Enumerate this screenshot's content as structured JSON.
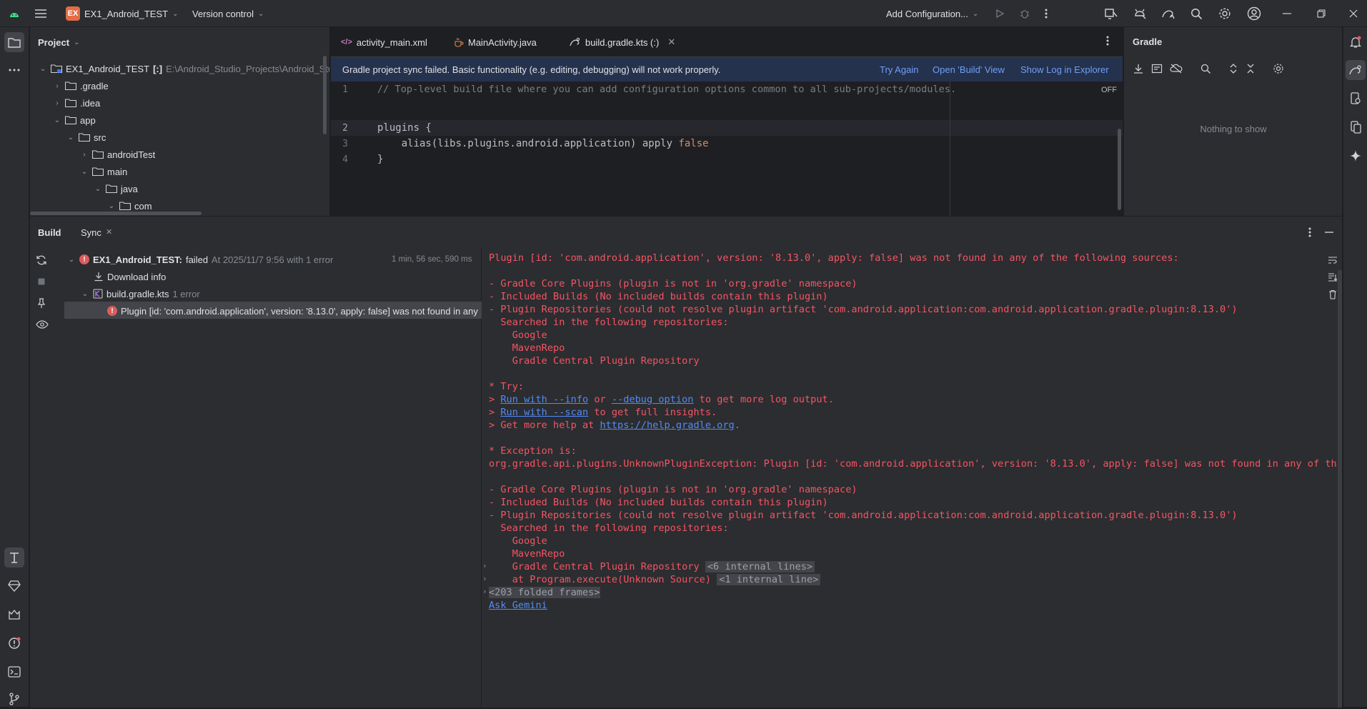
{
  "titlebar": {
    "project_badge": "EX",
    "project_name": "EX1_Android_TEST",
    "vcs": "Version control",
    "run_config": "Add Configuration..."
  },
  "project_panel": {
    "title": "Project",
    "tree": [
      {
        "label": "EX1_Android_TEST",
        "suffix": "[:]",
        "path": "E:\\Android_Studio_Projects\\Android_Stud"
      },
      {
        "label": ".gradle"
      },
      {
        "label": ".idea"
      },
      {
        "label": "app"
      },
      {
        "label": "src"
      },
      {
        "label": "androidTest"
      },
      {
        "label": "main"
      },
      {
        "label": "java"
      },
      {
        "label": "com"
      }
    ]
  },
  "editor": {
    "tabs": [
      {
        "label": "activity_main.xml"
      },
      {
        "label": "MainActivity.java"
      },
      {
        "label": "build.gradle.kts (:)"
      }
    ],
    "banner": {
      "message": "Gradle project sync failed. Basic functionality (e.g. editing, debugging) will not work properly.",
      "try_again": "Try Again",
      "open_build": "Open 'Build' View",
      "show_log": "Show Log in Explorer"
    },
    "off_label": "OFF",
    "lines": [
      {
        "num": "1",
        "text": "// Top-level build file where you can add configuration options common to all sub-projects/modules."
      },
      {
        "num": "2",
        "text": "plugins {"
      },
      {
        "num": "3",
        "text": "    alias(libs.plugins.android.application) apply ",
        "kw": "false"
      },
      {
        "num": "4",
        "text": "}"
      }
    ]
  },
  "gradle_panel": {
    "title": "Gradle",
    "empty": "Nothing to show"
  },
  "build_panel": {
    "tab_build": "Build",
    "tab_sync": "Sync",
    "tree": {
      "root_name": "EX1_Android_TEST:",
      "root_status": "failed",
      "root_time": "At 2025/11/7 9:56 with 1 error",
      "duration": "1 min, 56 sec, 590 ms",
      "download": "Download info",
      "file": "build.gradle.kts",
      "file_errors": "1 error",
      "error_msg": "Plugin [id: 'com.android.application', version: '8.13.0', apply: false] was not found in any"
    },
    "console": {
      "line_01": "Plugin [id: 'com.android.application', version: '8.13.0', apply: false] was not found in any of the following sources:",
      "line_02": "- Gradle Core Plugins (plugin is not in 'org.gradle' namespace)",
      "line_03": "- Included Builds (No included builds contain this plugin)",
      "line_04": "- Plugin Repositories (could not resolve plugin artifact 'com.android.application:com.android.application.gradle.plugin:8.13.0')",
      "line_05": "  Searched in the following repositories:",
      "line_06": "    Google",
      "line_07": "    MavenRepo",
      "line_08": "    Gradle Central Plugin Repository",
      "try": "* Try:",
      "try1_pre": "> ",
      "try1_link1": "Run with --info",
      "try1_mid": " or ",
      "try1_link2": "--debug option",
      "try1_post": " to get more log output.",
      "try2_link": "Run with --scan",
      "try2_post": " to get full insights.",
      "try3_pre": "> Get more help at ",
      "try3_link": "https://help.gradle.org",
      "try3_post": ".",
      "exc": "* Exception is:",
      "exc_line": "org.gradle.api.plugins.UnknownPluginException: Plugin [id: 'com.android.application', version: '8.13.0', apply: false] was not found in any of th",
      "b_02": "- Gradle Core Plugins (plugin is not in 'org.gradle' namespace)",
      "b_03": "- Included Builds (No included builds contain this plugin)",
      "b_04": "- Plugin Repositories (could not resolve plugin artifact 'com.android.application:com.android.application.gradle.plugin:8.13.0')",
      "b_05": "  Searched in the following repositories:",
      "b_06": "    Google",
      "b_07": "    MavenRepo",
      "b_08": "    Gradle Central Plugin Repository",
      "fold1": "<6 internal lines>",
      "b_09": "    at Program.execute(Unknown Source)",
      "fold2": "<1 internal line>",
      "fold3": "<203 folded frames>",
      "ask": "Ask Gemini"
    }
  },
  "colors": {
    "accent": "#3574f0",
    "error": "#f75464",
    "link": "#548af7",
    "banner": "#25324d"
  }
}
